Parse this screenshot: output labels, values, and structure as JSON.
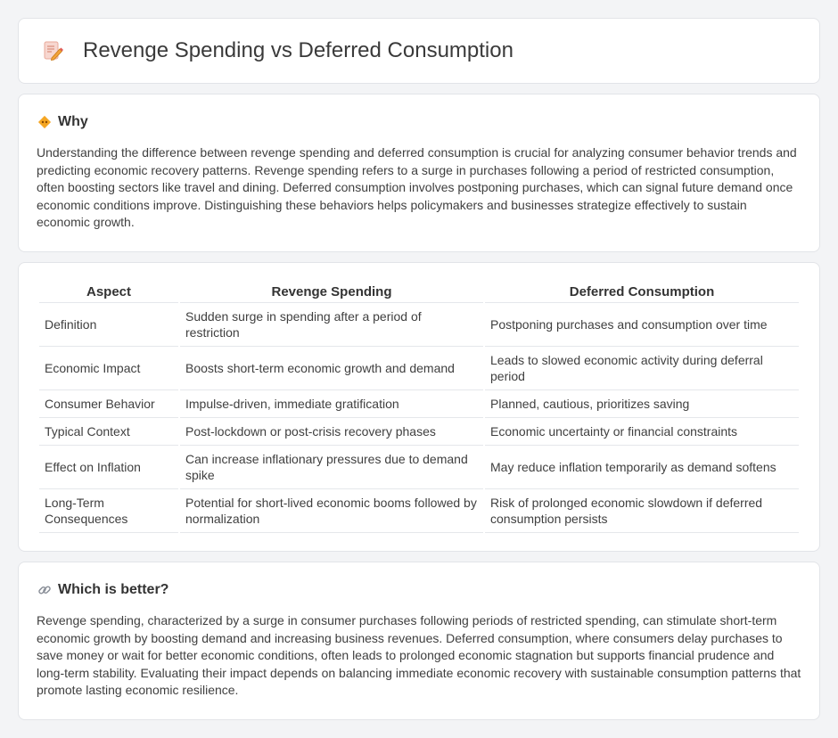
{
  "header": {
    "title": "Revenge Spending vs Deferred Consumption",
    "icon": "document-pencil-icon"
  },
  "why": {
    "heading": "Why",
    "icon": "diamond-warning-icon",
    "text": "Understanding the difference between revenge spending and deferred consumption is crucial for analyzing consumer behavior trends and predicting economic recovery patterns. Revenge spending refers to a surge in purchases following a period of restricted consumption, often boosting sectors like travel and dining. Deferred consumption involves postponing purchases, which can signal future demand once economic conditions improve. Distinguishing these behaviors helps policymakers and businesses strategize effectively to sustain economic growth."
  },
  "table": {
    "headers": [
      "Aspect",
      "Revenge Spending",
      "Deferred Consumption"
    ],
    "rows": [
      [
        "Definition",
        "Sudden surge in spending after a period of restriction",
        "Postponing purchases and consumption over time"
      ],
      [
        "Economic Impact",
        "Boosts short-term economic growth and demand",
        "Leads to slowed economic activity during deferral period"
      ],
      [
        "Consumer Behavior",
        "Impulse-driven, immediate gratification",
        "Planned, cautious, prioritizes saving"
      ],
      [
        "Typical Context",
        "Post-lockdown or post-crisis recovery phases",
        "Economic uncertainty or financial constraints"
      ],
      [
        "Effect on Inflation",
        "Can increase inflationary pressures due to demand spike",
        "May reduce inflation temporarily as demand softens"
      ],
      [
        "Long-Term Consequences",
        "Potential for short-lived economic booms followed by normalization",
        "Risk of prolonged economic slowdown if deferred consumption persists"
      ]
    ]
  },
  "better": {
    "heading": "Which is better?",
    "icon": "link-icon",
    "text": "Revenge spending, characterized by a surge in consumer purchases following periods of restricted spending, can stimulate short-term economic growth by boosting demand and increasing business revenues. Deferred consumption, where consumers delay purchases to save money or wait for better economic conditions, often leads to prolonged economic stagnation but supports financial prudence and long-term stability. Evaluating their impact depends on balancing immediate economic recovery with sustainable consumption patterns that promote lasting economic resilience."
  }
}
